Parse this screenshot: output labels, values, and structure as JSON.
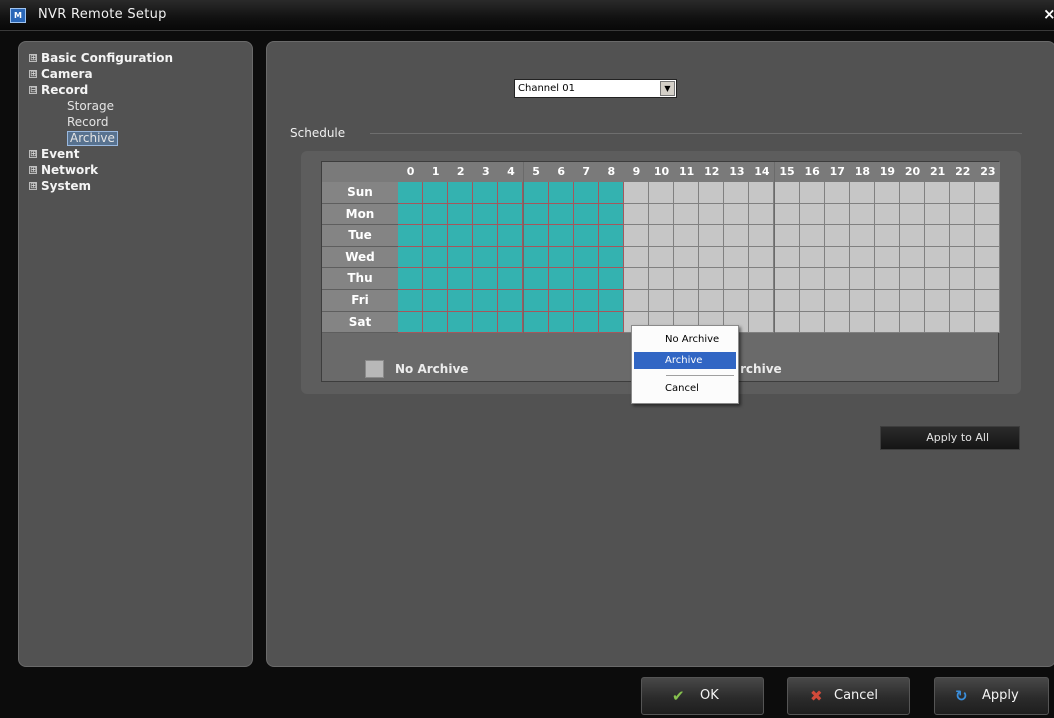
{
  "window": {
    "title": "NVR Remote Setup",
    "icon_letters": "M",
    "close_icon": "close-icon"
  },
  "tree": {
    "nodes": [
      {
        "label": "Basic Configuration",
        "expander": "⊞"
      },
      {
        "label": "Camera",
        "expander": "⊞"
      },
      {
        "label": "Record",
        "expander": "⊟",
        "children": [
          "Storage",
          "Record",
          "Archive"
        ],
        "selected_child": "Archive"
      },
      {
        "label": "Event",
        "expander": "⊞"
      },
      {
        "label": "Network",
        "expander": "⊞"
      },
      {
        "label": "System",
        "expander": "⊞"
      }
    ]
  },
  "channel": {
    "value": "Channel 01",
    "arrow": "▼"
  },
  "schedule": {
    "section_label": "Schedule",
    "hours": [
      "0",
      "1",
      "2",
      "3",
      "4",
      "5",
      "6",
      "7",
      "8",
      "9",
      "10",
      "11",
      "12",
      "13",
      "14",
      "15",
      "16",
      "17",
      "18",
      "19",
      "20",
      "21",
      "22",
      "23"
    ],
    "days": [
      "Sun",
      "Mon",
      "Tue",
      "Wed",
      "Thu",
      "Fri",
      "Sat"
    ],
    "selected_range": {
      "days": [
        "Sun",
        "Mon",
        "Tue",
        "Wed",
        "Thu",
        "Fri",
        "Sat"
      ],
      "hour_start": 0,
      "hour_end": 8
    },
    "legend": [
      {
        "label": "No Archive",
        "color": "#b8b8b8"
      },
      {
        "label": "rchive",
        "color": "#34b2b0"
      }
    ],
    "colors": {
      "on": "#34b2b0",
      "off": "#c6c6c6",
      "on_border": "#a4585d"
    }
  },
  "context_menu": {
    "items": [
      "No Archive",
      "Archive",
      "Cancel"
    ],
    "highlighted": "Archive"
  },
  "buttons": {
    "apply_to_all": "Apply to All",
    "ok": "OK",
    "cancel": "Cancel",
    "apply": "Apply"
  },
  "colors": {
    "accent": "#3166c4",
    "ok_icon": "#86c14e",
    "cancel_icon": "#d04a3a",
    "apply_icon": "#3a8edb"
  }
}
